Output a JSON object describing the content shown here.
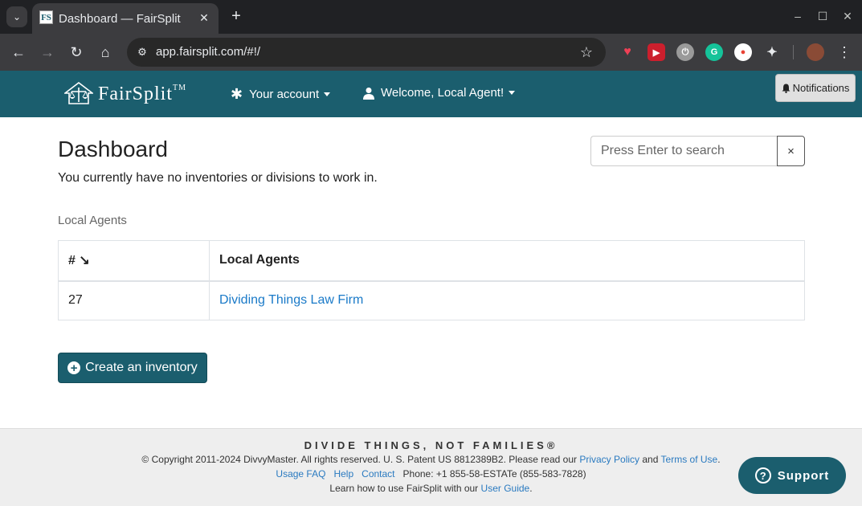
{
  "browser": {
    "tab_title": "Dashboard — FairSplit",
    "favicon_text": "FS",
    "url": "app.fairsplit.com/#!/",
    "icons": {
      "tab_search": "chevron-down-icon",
      "close": "close-icon",
      "new_tab": "plus-icon",
      "back": "arrow-left-icon",
      "forward": "arrow-right-icon",
      "reload": "reload-icon",
      "home": "home-icon",
      "site_info": "tune-icon",
      "bookmark": "star-icon",
      "menu": "kebab-icon"
    }
  },
  "header": {
    "brand": "FairSplit",
    "brand_tm": "TM",
    "account_menu": "Your account",
    "user_menu": "Welcome, Local Agent!",
    "notifications": "Notifications",
    "brand_color": "#1b5e6e"
  },
  "main": {
    "title": "Dashboard",
    "notice": "You currently have no inventories or divisions to work in.",
    "search": {
      "placeholder": "Press Enter to search",
      "value": "",
      "clear": "×"
    },
    "section_label": "Local Agents",
    "table": {
      "headers": [
        "# ↘",
        "Local Agents"
      ],
      "rows": [
        {
          "num": "27",
          "name": "Dividing Things Law Firm"
        }
      ]
    },
    "create_button": "Create an inventory"
  },
  "footer": {
    "tagline": "DIVIDE THINGS, NOT FAMILIES®",
    "copyright": "© Copyright 2011-2024 DivvyMaster.  All rights reserved.  U. S. Patent US 8812389B2.  Please read our",
    "privacy": "Privacy Policy",
    "and": "and",
    "terms": "Terms of Use",
    "period": ".",
    "usage_faq": "Usage FAQ",
    "help": "Help",
    "contact": "Contact",
    "phone": "Phone: +1 855-58-ESTATe (855-583-7828)",
    "learn": "Learn how to use FairSplit with our",
    "user_guide": "User Guide",
    "support": "Support"
  }
}
